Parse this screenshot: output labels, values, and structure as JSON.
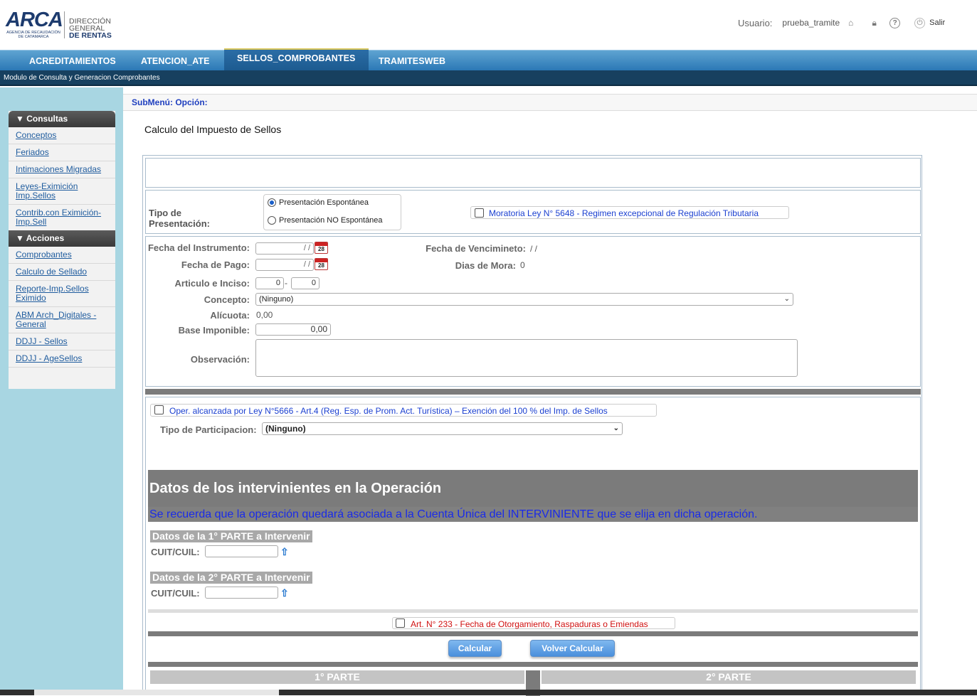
{
  "header": {
    "logo_text": "ARCA",
    "logo_sub": "AGENCIA DE RECAUDACIÓN DE CATAMARCA",
    "dg_line1": "DIRECCIÓN GENERAL",
    "dg_line2": "DE RENTAS",
    "usuario_label": "Usuario:",
    "username": "prueba_tramite",
    "salir": "Salir"
  },
  "topnav": {
    "tabs": [
      {
        "label": "ACREDITAMIENTOS"
      },
      {
        "label": "ATENCION_ATE"
      },
      {
        "label": "SELLOS_COMPROBANTES",
        "active": true
      },
      {
        "label": "TRAMITESWEB"
      }
    ]
  },
  "module_bar": "Modulo de Consulta y Generacion Comprobantes",
  "sidebar": {
    "consultas_title": "▼ Consultas",
    "consultas": [
      {
        "label": "Conceptos"
      },
      {
        "label": "Feriados"
      },
      {
        "label": "Intimaciones Migradas"
      },
      {
        "label": "Leyes-Eximición Imp.Sellos"
      },
      {
        "label": "Contrib.con Eximición-Imp.Sell"
      }
    ],
    "acciones_title": "▼ Acciones",
    "acciones": [
      {
        "label": "Comprobantes"
      },
      {
        "label": "Calculo de Sellado"
      },
      {
        "label": "Reporte-Imp.Sellos Eximido"
      },
      {
        "label": "ABM Arch_Digitales - General"
      },
      {
        "label": "DDJJ - Sellos"
      },
      {
        "label": "DDJJ - AgeSellos"
      }
    ]
  },
  "submenu": "SubMenú: Opción:",
  "page_title": "Calculo del Impuesto de Sellos",
  "presentacion": {
    "label": "Tipo de Presentación:",
    "option1": "Presentación Espontánea",
    "option2": "Presentación NO Espontánea",
    "moratoria": "Moratoria Ley N° 5648 - Regimen excepcional de Regulación Tributaria"
  },
  "form": {
    "fecha_instrumento_label": "Fecha del Instrumento:",
    "fecha_instrumento_value": "/ /",
    "fecha_pago_label": "Fecha de Pago:",
    "fecha_pago_value": "/ /",
    "calendar_day": "28",
    "fecha_venc_label": "Fecha de Vencimineto:",
    "fecha_venc_value": "/ /",
    "dias_mora_label": "Dias de Mora:",
    "dias_mora_value": "0",
    "articulo_label": "Articulo e Inciso:",
    "articulo_value": "0",
    "articulo_sep": "-",
    "inciso_value": "0",
    "concepto_label": "Concepto:",
    "concepto_value": "(Ninguno)",
    "alicuota_label": "Alícuota:",
    "alicuota_value": "0,00",
    "base_label": "Base Imponible:",
    "base_value": "0,00",
    "observacion_label": "Observación:"
  },
  "ley5666": "Oper. alcanzada por Ley N°5666 - Art.4 (Reg. Esp. de Prom. Act. Turística) – Exención del 100 % del Imp. de Sellos",
  "participacion": {
    "label": "Tipo de Participacion:",
    "value": "(Ninguno)"
  },
  "intervinientes": {
    "title": "Datos de los intervinientes en la Operación",
    "notice": "Se recuerda que la operación quedará asociada a la Cuenta Única del INTERVINIENTE que se elija en dicha operación.",
    "parte1_title": "Datos de la 1° PARTE a Intervenir",
    "parte2_title": "Datos de la 2° PARTE a Intervenir",
    "cuit_label": "CUIT/CUIL:"
  },
  "art233": "Art. N° 233 - Fecha de Otorgamiento, Raspaduras o Emiendas",
  "buttons": {
    "calcular": "Calcular",
    "volver": "Volver Calcular"
  },
  "parts": {
    "parte1": "1° PARTE",
    "parte2": "2° PARTE"
  },
  "colors": {
    "nav_blue": "#2b78b6",
    "module_bar": "#17405f",
    "sidebar_bg": "#a8d6e2",
    "link_blue": "#1a3fd0",
    "red_text": "#d01010"
  }
}
